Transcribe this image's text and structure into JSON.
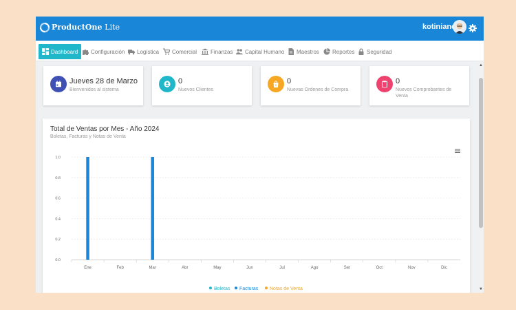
{
  "header": {
    "brand": "ProductOne",
    "brand_suffix": "Lite",
    "user": "kotinianor"
  },
  "menu": [
    {
      "label": "Dashboard",
      "icon": "dashboard-icon",
      "active": true
    },
    {
      "label": "Configuración",
      "icon": "puzzle-icon"
    },
    {
      "label": "Logística",
      "icon": "truck-icon"
    },
    {
      "label": "Comercial",
      "icon": "cart-icon"
    },
    {
      "label": "Finanzas",
      "icon": "bank-icon"
    },
    {
      "label": "Capital Humano",
      "icon": "people-icon"
    },
    {
      "label": "Maestros",
      "icon": "document-icon"
    },
    {
      "label": "Reportes",
      "icon": "pie-chart-icon"
    },
    {
      "label": "Seguridad",
      "icon": "lock-icon"
    }
  ],
  "cards": [
    {
      "value": "Jueves 28 de Marzo",
      "label": "Bienvenidos al sistema",
      "color": "#3f51b5",
      "icon": "calendar-icon"
    },
    {
      "value": "0",
      "label": "Nuevos Clientes",
      "color": "#1fb7c9",
      "icon": "user-circle-icon"
    },
    {
      "value": "0",
      "label": "Nuevas Ordenes de Compra",
      "color": "#f6a723",
      "icon": "shopping-bag-icon"
    },
    {
      "value": "0",
      "label": "Nuevos Comprobantes de Venta",
      "color": "#f0426e",
      "icon": "clipboard-icon"
    }
  ],
  "chart": {
    "title": "Total de Ventas por Mes - Año 2024",
    "subtitle": "Boletas, Facturas y Notas de Venta"
  },
  "chart_data": {
    "type": "bar",
    "categories": [
      "Ene",
      "Feb",
      "Mar",
      "Abr",
      "May",
      "Jun",
      "Jul",
      "Ago",
      "Set",
      "Oct",
      "Nov",
      "Dic"
    ],
    "series": [
      {
        "name": "Boletas",
        "color": "#1fb7c9",
        "values": [
          0,
          0,
          0,
          0,
          0,
          0,
          0,
          0,
          0,
          0,
          0,
          0
        ]
      },
      {
        "name": "Facturas",
        "color": "#1a86d8",
        "values": [
          1,
          0,
          1,
          0,
          0,
          0,
          0,
          0,
          0,
          0,
          0,
          0
        ]
      },
      {
        "name": "Notas de Venta",
        "color": "#f6a723",
        "values": [
          0,
          0,
          0,
          0,
          0,
          0,
          0,
          0,
          0,
          0,
          0,
          0
        ]
      }
    ],
    "yticks": [
      "0.0",
      "0.2",
      "0.4",
      "0.6",
      "0.8",
      "1.0"
    ],
    "ylim": [
      0,
      1
    ],
    "grid": true,
    "legend": "bottom"
  }
}
